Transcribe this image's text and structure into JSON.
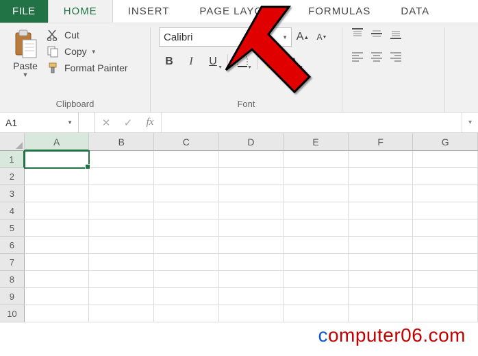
{
  "tabs": {
    "file": "FILE",
    "home": "HOME",
    "insert": "INSERT",
    "pagelayout": "PAGE LAYOUT",
    "formulas": "FORMULAS",
    "data": "DATA"
  },
  "clipboard": {
    "paste": "Paste",
    "cut": "Cut",
    "copy": "Copy",
    "format_painter": "Format Painter",
    "group_label": "Clipboard"
  },
  "font": {
    "name": "Calibri",
    "size_placeholder": "",
    "bold": "B",
    "italic": "I",
    "underline": "U",
    "group_label": "Font",
    "increase": "A",
    "decrease": "A",
    "font_color_letter": "A"
  },
  "alignment": {
    "group_label": ""
  },
  "formula_bar": {
    "name_box": "A1",
    "cancel": "✕",
    "enter": "✓",
    "fx": "fx"
  },
  "grid": {
    "columns": [
      "A",
      "B",
      "C",
      "D",
      "E",
      "F",
      "G"
    ],
    "selected_col": "A",
    "rows": [
      "1",
      "2",
      "3",
      "4",
      "5",
      "6",
      "7",
      "8",
      "9",
      "10"
    ],
    "selected_row": "1",
    "active_cell": "A1"
  },
  "watermark": {
    "part1": "c",
    "part2": "omputer06.com"
  }
}
